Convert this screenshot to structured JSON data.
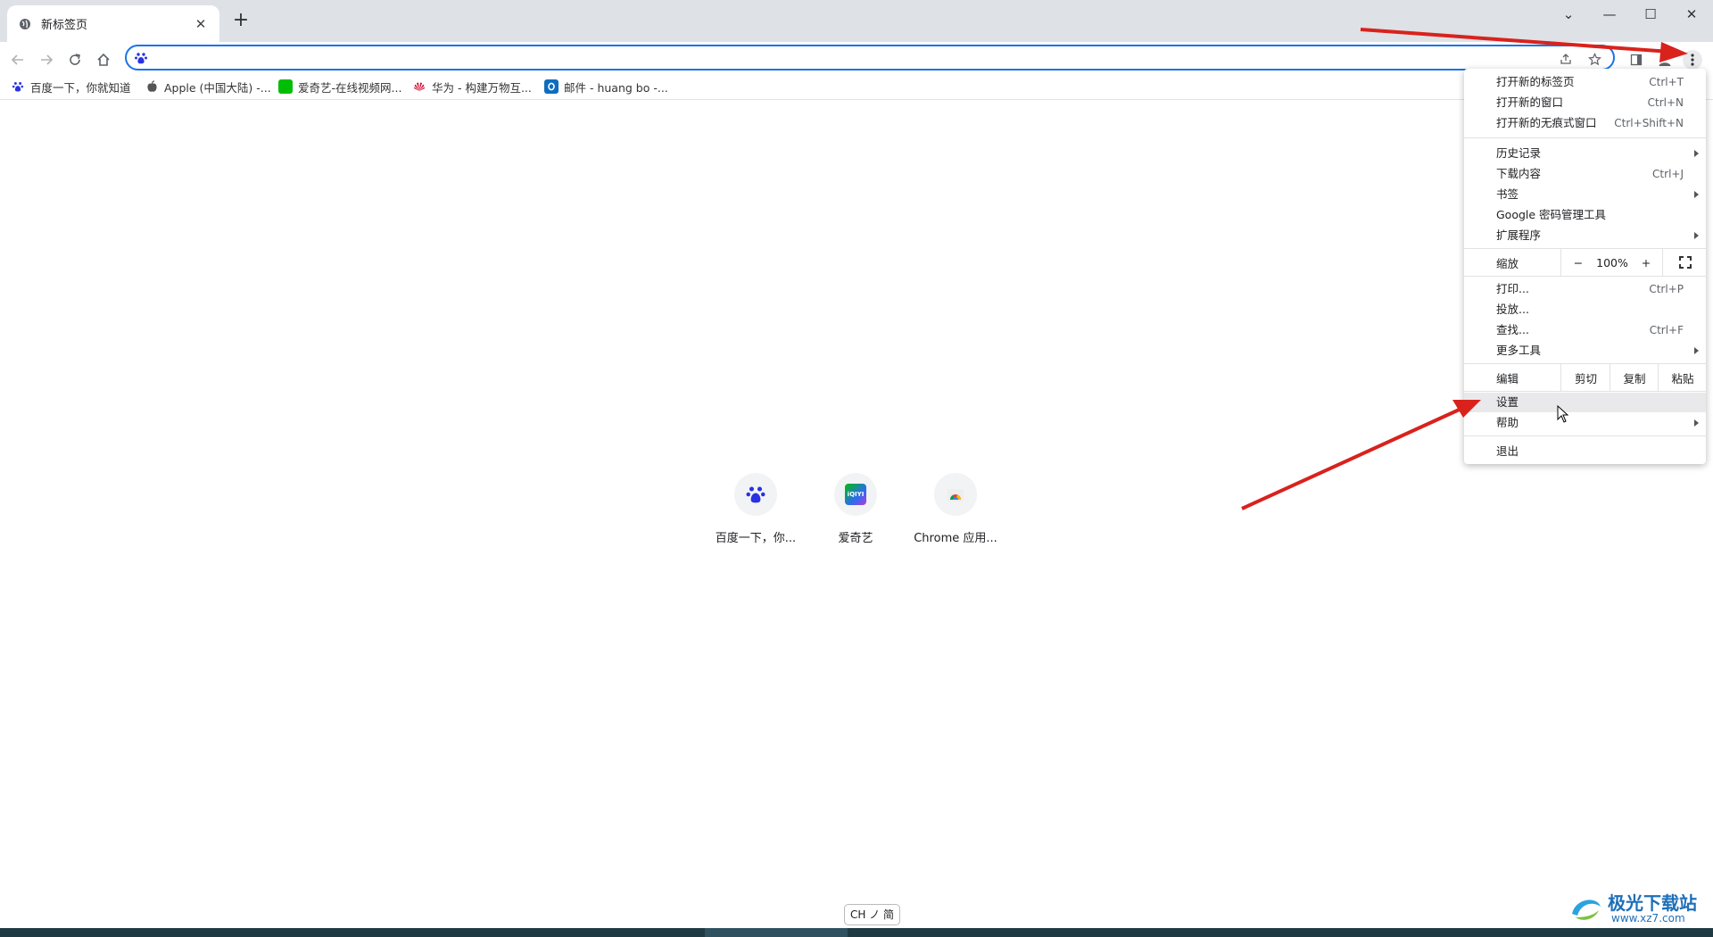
{
  "tab": {
    "title": "新标签页",
    "close_symbol": "✕",
    "new_tab_symbol": "+"
  },
  "window_controls": {
    "tabsearch": "⌄",
    "minimize": "—",
    "maximize": "☐",
    "close": "✕"
  },
  "omnibox": {
    "value": "",
    "placeholder": ""
  },
  "bookmarks": [
    {
      "label": "百度一下，你就知道",
      "icon": "baidu-icon",
      "color": "#2932e1"
    },
    {
      "label": "Apple (中国大陆) -...",
      "icon": "apple-icon",
      "color": "#555555"
    },
    {
      "label": "爱奇艺-在线视频网...",
      "icon": "iqiyi-icon",
      "color": "#00be06"
    },
    {
      "label": "华为 - 构建万物互...",
      "icon": "huawei-icon",
      "color": "#cf0a2c"
    },
    {
      "label": "邮件 - huang bo -...",
      "icon": "outlook-icon",
      "color": "#0f6cbd"
    }
  ],
  "shortcuts": [
    {
      "label": "百度一下，你...",
      "icon": "baidu-icon"
    },
    {
      "label": "爱奇艺",
      "icon": "iqiyi-icon",
      "icon_text": "iQIYI"
    },
    {
      "label": "Chrome 应用...",
      "icon": "chrome-web-store-icon"
    }
  ],
  "menu": {
    "new_tab": {
      "label": "打开新的标签页",
      "shortcut": "Ctrl+T"
    },
    "new_window": {
      "label": "打开新的窗口",
      "shortcut": "Ctrl+N"
    },
    "incognito": {
      "label": "打开新的无痕式窗口",
      "shortcut": "Ctrl+Shift+N"
    },
    "history": {
      "label": "历史记录"
    },
    "downloads": {
      "label": "下载内容",
      "shortcut": "Ctrl+J"
    },
    "bookmarks": {
      "label": "书签"
    },
    "passwords": {
      "label": "Google 密码管理工具"
    },
    "extensions": {
      "label": "扩展程序"
    },
    "zoom": {
      "label": "缩放",
      "minus": "−",
      "value": "100%",
      "plus": "+"
    },
    "print": {
      "label": "打印...",
      "shortcut": "Ctrl+P"
    },
    "cast": {
      "label": "投放..."
    },
    "find": {
      "label": "查找...",
      "shortcut": "Ctrl+F"
    },
    "more_tools": {
      "label": "更多工具"
    },
    "edit": {
      "label": "编辑",
      "cut": "剪切",
      "copy": "复制",
      "paste": "粘贴"
    },
    "settings": {
      "label": "设置"
    },
    "help": {
      "label": "帮助"
    },
    "exit": {
      "label": "退出"
    }
  },
  "ime": {
    "label": "CH ノ 简"
  },
  "watermark": {
    "title": "极光下载站",
    "url": "www.xz7.com"
  },
  "colors": {
    "accent": "#1a73e8",
    "annotation": "#d9221c",
    "tabstrip": "#dee1e6"
  }
}
